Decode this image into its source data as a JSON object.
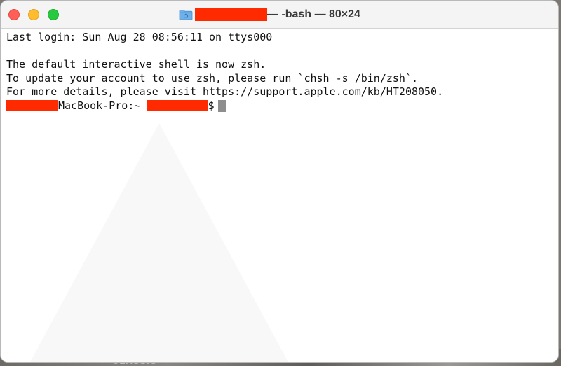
{
  "window": {
    "title_suffix": "— -bash — 80×24"
  },
  "terminal": {
    "lines": [
      "Last login: Sun Aug 28 08:56:11 on ttys000",
      "",
      "The default interactive shell is now zsh.",
      "To update your account to use zsh, please run `chsh -s /bin/zsh`.",
      "For more details, please visit https://support.apple.com/kb/HT208050."
    ],
    "prompt": {
      "host": "MacBook-Pro:~",
      "symbol": "$"
    }
  },
  "desktop": {
    "background_text": "CLASSIC"
  },
  "colors": {
    "redaction": "#ff2a00",
    "close": "#ff5f57",
    "minimize": "#febc2e",
    "zoom": "#28c840"
  }
}
